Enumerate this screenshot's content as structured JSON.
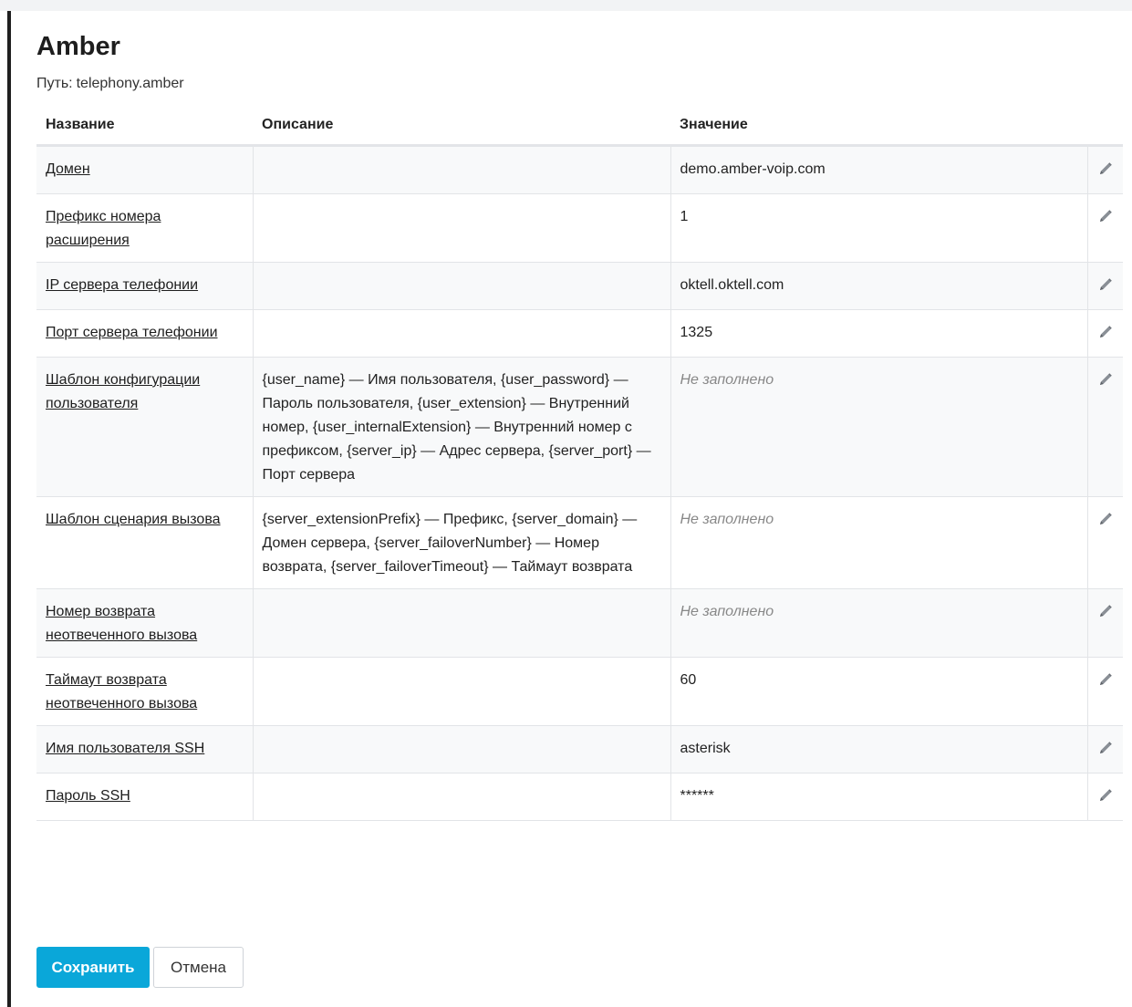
{
  "page": {
    "title": "Amber",
    "path_label": "Путь:",
    "path_value": "telephony.amber"
  },
  "table": {
    "headers": {
      "name": "Название",
      "description": "Описание",
      "value": "Значение"
    },
    "rows": [
      {
        "name": "Домен",
        "description": "",
        "value": "demo.amber-voip.com",
        "empty": false
      },
      {
        "name": "Префикс номера расширения",
        "description": "",
        "value": "1",
        "empty": false
      },
      {
        "name": "IP сервера телефонии",
        "description": "",
        "value": "oktell.oktell.com",
        "empty": false
      },
      {
        "name": "Порт сервера телефонии",
        "description": "",
        "value": "1325",
        "empty": false
      },
      {
        "name": "Шаблон конфигурации пользователя",
        "description": "{user_name} — Имя пользователя, {user_password} — Пароль пользователя, {user_extension} — Внутренний номер, {user_internalExtension} — Внутренний номер с префиксом, {server_ip} — Адрес сервера, {server_port} — Порт сервера",
        "value": "Не заполнено",
        "empty": true
      },
      {
        "name": "Шаблон сценария вызова",
        "description": "{server_extensionPrefix} — Префикс, {server_domain} — Домен сервера, {server_failoverNumber} — Номер возврата, {server_failoverTimeout} — Таймаут возврата",
        "value": "Не заполнено",
        "empty": true
      },
      {
        "name": "Номер возврата неотвеченного вызова",
        "description": "",
        "value": "Не заполнено",
        "empty": true
      },
      {
        "name": "Таймаут возврата неотвеченного вызова",
        "description": "",
        "value": "60",
        "empty": false
      },
      {
        "name": "Имя пользователя SSH",
        "description": "",
        "value": "asterisk",
        "empty": false
      },
      {
        "name": "Пароль SSH",
        "description": "",
        "value": "******",
        "empty": false
      }
    ],
    "edit_icon": "pencil-icon"
  },
  "actions": {
    "save_label": "Сохранить",
    "cancel_label": "Отмена"
  },
  "colors": {
    "primary": "#0aa7d9",
    "left_bar": "#1f1f1f",
    "empty_value": "#888888"
  }
}
